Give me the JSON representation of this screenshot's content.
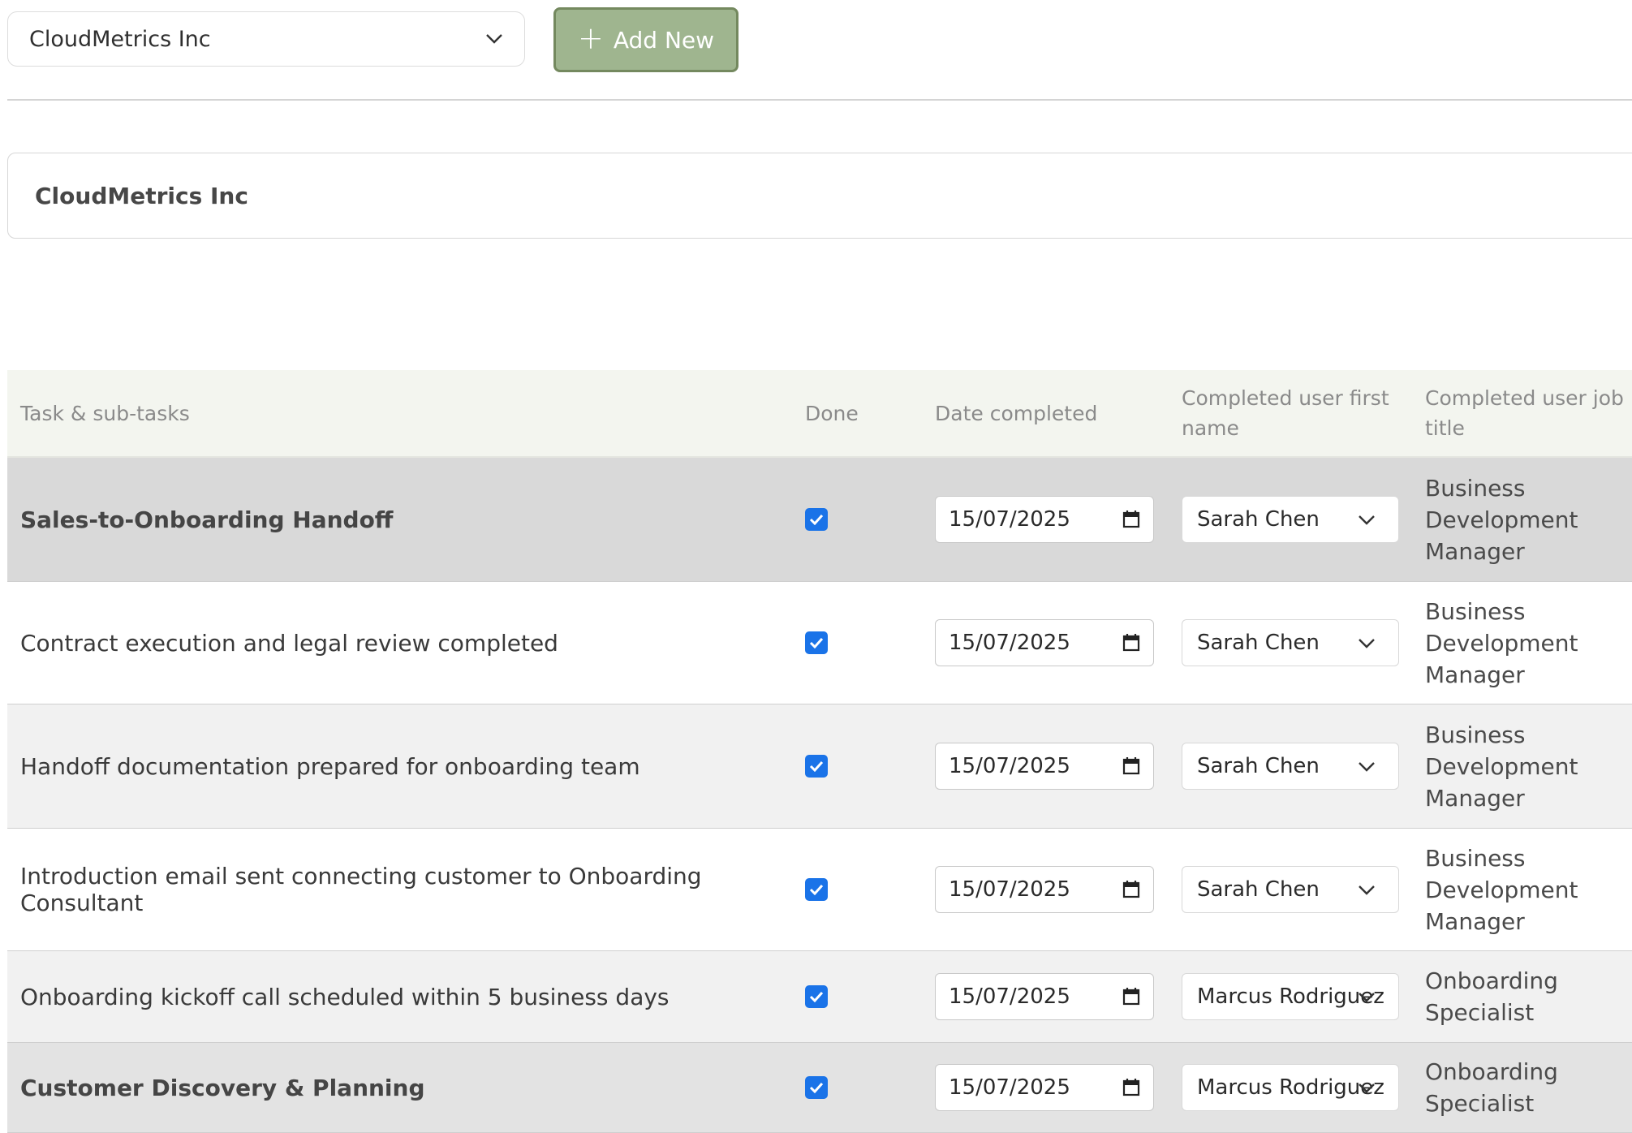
{
  "toolbar": {
    "company_select_value": "CloudMetrics Inc",
    "add_button_label": "Add New"
  },
  "company_card": {
    "title": "CloudMetrics Inc"
  },
  "table": {
    "headers": {
      "task": "Task & sub-tasks",
      "done": "Done",
      "date": "Date completed",
      "user_first_name": "Completed user first name",
      "user_job_title": "Completed user job title"
    },
    "rows": [
      {
        "task": "Sales-to-Onboarding Handoff",
        "done": true,
        "date": "15/07/2025",
        "user": "Sarah Chen",
        "job_title": "Business Development Manager"
      },
      {
        "task": "Contract execution and legal review completed",
        "done": true,
        "date": "15/07/2025",
        "user": "Sarah Chen",
        "job_title": "Business Development Manager"
      },
      {
        "task": "Handoff documentation prepared for onboarding team",
        "done": true,
        "date": "15/07/2025",
        "user": "Sarah Chen",
        "job_title": "Business Development Manager"
      },
      {
        "task": "Introduction email sent connecting customer to Onboarding Consultant",
        "done": true,
        "date": "15/07/2025",
        "user": "Sarah Chen",
        "job_title": "Business Development Manager"
      },
      {
        "task": "Onboarding kickoff call scheduled within 5 business days",
        "done": true,
        "date": "15/07/2025",
        "user": "Marcus Rodriguez",
        "job_title": "Onboarding Specialist"
      },
      {
        "task": "Customer Discovery & Planning",
        "done": true,
        "date": "15/07/2025",
        "user": "Marcus Rodriguez",
        "job_title": "Onboarding Specialist"
      }
    ]
  },
  "icons": {
    "chevron": "chevron-down-icon",
    "calendar": "calendar-icon",
    "check": "check-icon",
    "plus": "plus-icon"
  },
  "colors": {
    "accent_green": "#9fb58f",
    "checkbox_blue": "#1a73e8",
    "header_bg": "#f3f5ef"
  }
}
